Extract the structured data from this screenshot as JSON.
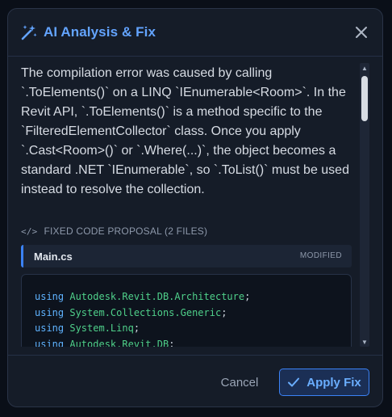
{
  "dialog": {
    "title": "AI Analysis & Fix",
    "title_icon": "magic-wand-icon",
    "close_icon": "close-icon",
    "explanation_lines": [
      "The compilation error was caused by calling",
      "`.ToElements()` on a LINQ `IEnumerable<Room>`. In the",
      "Revit API, `.ToElements()` is a method specific to the",
      "`FilteredElementCollector` class. Once you apply",
      "`.Cast<Room>()` or `.Where(...)`, the object becomes a",
      "standard .NET `IEnumerable`, so `.ToList()` must be used",
      "instead to resolve the collection."
    ],
    "section_icon": "code-icon",
    "section_icon_glyph": "</>",
    "section_label": "FIXED CODE PROPOSAL (2 FILES)",
    "file": {
      "name": "Main.cs",
      "status": "MODIFIED",
      "code": [
        {
          "kw": "using",
          "ns": "Autodesk.Revit.DB.Architecture",
          "end": ";"
        },
        {
          "kw": "using",
          "ns": "System.Collections.Generic",
          "end": ";"
        },
        {
          "kw": "using",
          "ns": "System.Linq",
          "end": ";"
        },
        {
          "kw": "using",
          "ns": "Autodesk.Revit.DB",
          "end": ";"
        }
      ]
    },
    "cancel_label": "Cancel",
    "apply_label": "Apply Fix",
    "apply_icon": "check-icon",
    "colors": {
      "accent": "#3b82f6",
      "title": "#63a4ff",
      "keyword": "#5fb3ff",
      "namespace": "#4fd08a",
      "background": "#151c28"
    }
  }
}
